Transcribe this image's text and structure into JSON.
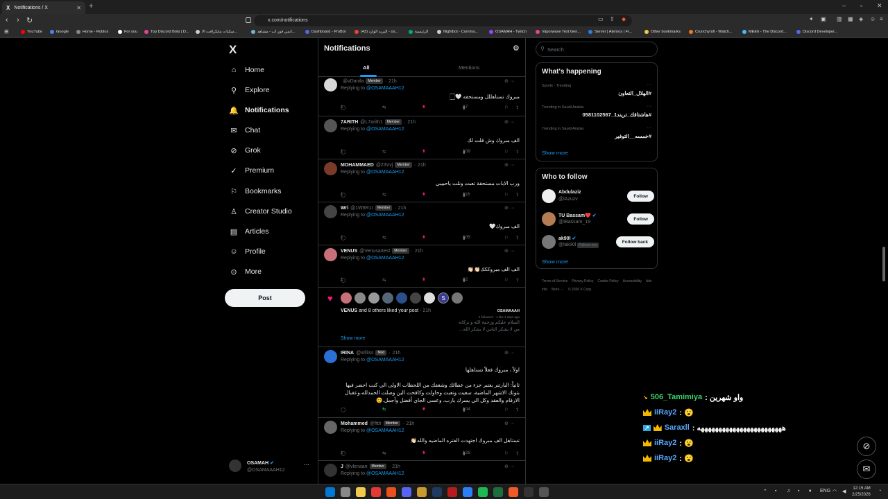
{
  "browser": {
    "tab_title": "Notifications / X",
    "tab_logo": "X",
    "url": "x.com/notifications",
    "bookmarks": [
      {
        "label": "YouTube",
        "color": "#ff0000"
      },
      {
        "label": "Google",
        "color": "#4285f4"
      },
      {
        "label": "Home - Roblox",
        "color": "#888888"
      },
      {
        "label": "For you",
        "color": "#ffffff"
      },
      {
        "label": "Top Discord Bots | D...",
        "color": "#e84393"
      },
      {
        "label": "سكنات مايكرافت الا...",
        "color": "#cccccc"
      },
      {
        "label": "انمي فور اب - مشاهد...",
        "color": "#6fb3d2"
      },
      {
        "label": "Dashboard - ProBot",
        "color": "#5865f2"
      },
      {
        "label": "(43) البريد الوارد - os...",
        "color": "#ea4335"
      },
      {
        "label": "الرئيسية",
        "color": "#00a884"
      },
      {
        "label": "Nightbot - Comma...",
        "color": "#cccccc"
      },
      {
        "label": "OSAMAH - Twitch",
        "color": "#9146ff"
      },
      {
        "label": "Vaporwave Text Gen...",
        "color": "#e84393"
      },
      {
        "label": "Server | Aternos | Fr...",
        "color": "#2a7de1"
      },
      {
        "label": "Other bookmarks",
        "color": "#f2c94c"
      },
      {
        "label": "Crunchyroll - Watch...",
        "color": "#f47521"
      },
      {
        "label": "MEE6 - The Discord...",
        "color": "#4ab9f7"
      },
      {
        "label": "Discord Developer...",
        "color": "#5865f2"
      }
    ]
  },
  "sidebar": {
    "logo": "X",
    "items": [
      {
        "label": "Home",
        "icon": "⌂"
      },
      {
        "label": "Explore",
        "icon": "⚲"
      },
      {
        "label": "Notifications",
        "icon": "🔔"
      },
      {
        "label": "Chat",
        "icon": "✉"
      },
      {
        "label": "Grok",
        "icon": "⊘"
      },
      {
        "label": "Premium",
        "icon": "✓"
      },
      {
        "label": "Bookmarks",
        "icon": "⚐"
      },
      {
        "label": "Creator Studio",
        "icon": "♙"
      },
      {
        "label": "Articles",
        "icon": "▤"
      },
      {
        "label": "Profile",
        "icon": "☺"
      },
      {
        "label": "More",
        "icon": "⊙"
      }
    ],
    "post_label": "Post",
    "account": {
      "name": "OSAMAH",
      "handle": "@OSAMAAAH12",
      "more": "···"
    }
  },
  "main": {
    "title": "Notifications",
    "tabs": [
      "All",
      "Mentions"
    ],
    "reply_prefix": "Replying to",
    "reply_target": "@OSAMAAAH12",
    "notifications": [
      {
        "name": "",
        "handle": "@vDanila",
        "badge": "Member",
        "time": "21h",
        "body": "مبروك تستاهللل ومستحقه 🤍🏻",
        "replies": "1",
        "retweets": "",
        "likes": "1",
        "views": "87",
        "avatar": "#d9d9d9"
      },
      {
        "name": "7ARITH",
        "handle": "@L7arith1",
        "badge": "Member",
        "time": "21h",
        "body": "الف مبروك وش قلت لك",
        "replies": "1",
        "retweets": "",
        "likes": "1",
        "views": "109",
        "avatar": "#555555"
      },
      {
        "name": "MOHAMMAED",
        "handle": "@23Vvj",
        "badge": "Member",
        "time": "21h",
        "body": "ورب الابات مستحقة تعبت ونلت ياحبيبي",
        "replies": "1",
        "retweets": "",
        "likes": "1",
        "views": "116",
        "avatar": "#7a3a2a"
      },
      {
        "name": "Wri",
        "handle": "@1W6R1r",
        "badge": "Member",
        "time": "21h",
        "body": "الف مبروك🤍",
        "replies": "1",
        "retweets": "",
        "likes": "1",
        "views": "105",
        "avatar": "#444444"
      },
      {
        "name": "VENUS",
        "handle": "@Venusartest",
        "badge": "Member",
        "time": "21h",
        "body": "الف الف مبروككك👏🏻👏🏻",
        "replies": "1",
        "retweets": "",
        "likes": "1",
        "views": "82",
        "avatar": "#c8707a"
      },
      {
        "name": "IRINA",
        "handle": "@xillilss",
        "badge": "Mod",
        "time": "21h",
        "body": "اولاً ، مبروك فعلاً تستاهلها\n\nثانياً: البارتنر يعتبر جزء من عطائك وشغفك من اللحظات الاولى الي كنت احضر فيها\nبثوثك الاشهر الماضية، سعيت وتعبت وحاولت وكافحت الين وصلت الحمدلله،وعقبال\nالارقام والعقد وكل الي يسرك يارب، وعسى الجاي أفضل وأجمل.😊",
        "replies": "",
        "retweets": "1",
        "likes": "2",
        "views": "104",
        "avatar": "#2a6fd6"
      },
      {
        "name": "Mohammed",
        "handle": "@fttlr",
        "badge": "Member",
        "time": "21h",
        "body": "تستاهل الف مبروك اجتهدت الفتره الماضيه والله👏🏻",
        "replies": "1",
        "retweets": "",
        "likes": "1",
        "views": "126",
        "avatar": "#666666"
      },
      {
        "name": "J",
        "handle": "@vlenaan",
        "badge": "Member",
        "time": "21h",
        "body": "",
        "replies": "",
        "retweets": "",
        "likes": "",
        "views": "",
        "avatar": "#333333"
      }
    ],
    "like_group": {
      "text_name": "VENUS",
      "text_rest": "and 8 others liked your post",
      "time": "21h",
      "quoted_line1": "السلام عليكم ورحمة الله و بركاته",
      "quoted_line2": "من لا يشكر الناس لا يشكر الله...",
      "quoted_name": "OSAMAAAH",
      "quoted_meta": "2 followers · 1 like 4 days ago",
      "show_more": "Show more",
      "avatars": [
        "#c8707a",
        "#888888",
        "#999999",
        "#556677",
        "#2b4f8a",
        "#444444",
        "#dddddd",
        "#3b3b8f",
        "#777777"
      ],
      "avatar_labels": [
        "",
        "",
        "",
        "",
        "",
        "",
        "",
        "S",
        ""
      ]
    }
  },
  "right": {
    "search_placeholder": "Search",
    "happening": {
      "title": "What's happening",
      "trends": [
        {
          "category": "Sports · Trending",
          "name": "#الهلال_التعاون"
        },
        {
          "category": "Trending in Saudi Arabia",
          "name": "#هاشتاقك_تريند1_0581102567"
        },
        {
          "category": "Trending in Saudi Arabia",
          "name": "#خمسه__التوفير"
        }
      ],
      "show_more": "Show more"
    },
    "who_to_follow": {
      "title": "Who to follow",
      "people": [
        {
          "name": "Abdulaziz",
          "handle": "@iAzuzv",
          "button": "Follow",
          "follows_you": "",
          "avatar": "#eeeeee"
        },
        {
          "name": "TU Bassam❤️",
          "handle": "@IBassam_19",
          "button": "Follow",
          "follows_you": "",
          "avatar": "#b57b55"
        },
        {
          "name": "ak90l",
          "handle": "@lak90l",
          "button": "Follow back",
          "follows_you": "Follows you",
          "avatar": "#777777"
        }
      ],
      "show_more": "Show more"
    },
    "footer": [
      "Terms of Service",
      "Privacy Policy",
      "Cookie Policy",
      "Accessibility",
      "Ads info",
      "More ···",
      "© 2026 X Corp."
    ]
  },
  "chat_overlay": [
    {
      "badge": "arrow",
      "user": "506_Tamimiya",
      "msg": ": واو شهرين"
    },
    {
      "badge": "crown",
      "user": "iiRay2",
      "msg": ": 😮"
    },
    {
      "badge": "crown-arrow",
      "user": "Saraxll",
      "msg": ": ههههههههههههههههههههههههه"
    },
    {
      "badge": "crown",
      "user": "iiRay2",
      "msg": ": 😮"
    },
    {
      "badge": "crown",
      "user": "iiRay2",
      "msg": ": 😮"
    }
  ],
  "taskbar": {
    "tray_lang": "ENG",
    "time": "12:15 AM",
    "date": "2/25/2026",
    "icons": [
      "#0078d4",
      "#888888",
      "#f2c94c",
      "#e53935",
      "#e8501c",
      "#5865f2",
      "#c99a2e",
      "#1e3a5f",
      "#b71c1c",
      "#2d7ff9",
      "#1db954",
      "#1d6e3f",
      "#f05a28",
      "#333333",
      "#555555"
    ]
  }
}
